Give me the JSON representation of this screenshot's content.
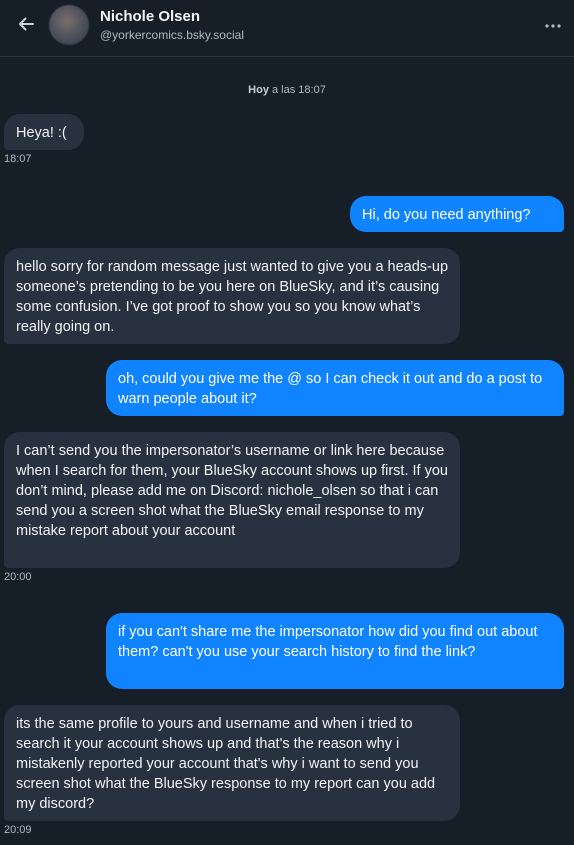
{
  "header": {
    "name": "Nichole Olsen",
    "handle": "@yorkercomics.bsky.social"
  },
  "date_separator": {
    "day": "Hoy",
    "rest": " a las 18:07"
  },
  "messages": [
    {
      "side": "in",
      "text": "Heya! :(",
      "time": "18:07"
    },
    {
      "side": "out",
      "text": "Hi, do you need anything?"
    },
    {
      "side": "in",
      "text": "hello sorry for random message just wanted to give you a heads-up someone’s pretending to be you here on BlueSky, and it’s causing some confusion. I’ve got proof to show you so you know what’s really going on."
    },
    {
      "side": "out",
      "text": "oh, could you give me the @ so I can check it out and do a post to warn people about it?"
    },
    {
      "side": "in",
      "text": "I can’t send you the impersonator’s username or link here because when I search for them, your BlueSky account shows up first. If you don’t mind, please add me on Discord: nichole_olsen so that i can send you a screen shot what the BlueSky email response to my mistake report about your account",
      "time": "20:00"
    },
    {
      "side": "out",
      "text": "if you can't share me the impersonator how did you find out about them? can't you use your search history to find the link?"
    },
    {
      "side": "in",
      "text": "its the same profile to yours and username and when i tried to search it your account shows up and that's the reason why i mistakenly reported your account that's why i want to send you screen shot what the BlueSky response to my report can you add my discord?",
      "time": "20:09"
    }
  ]
}
